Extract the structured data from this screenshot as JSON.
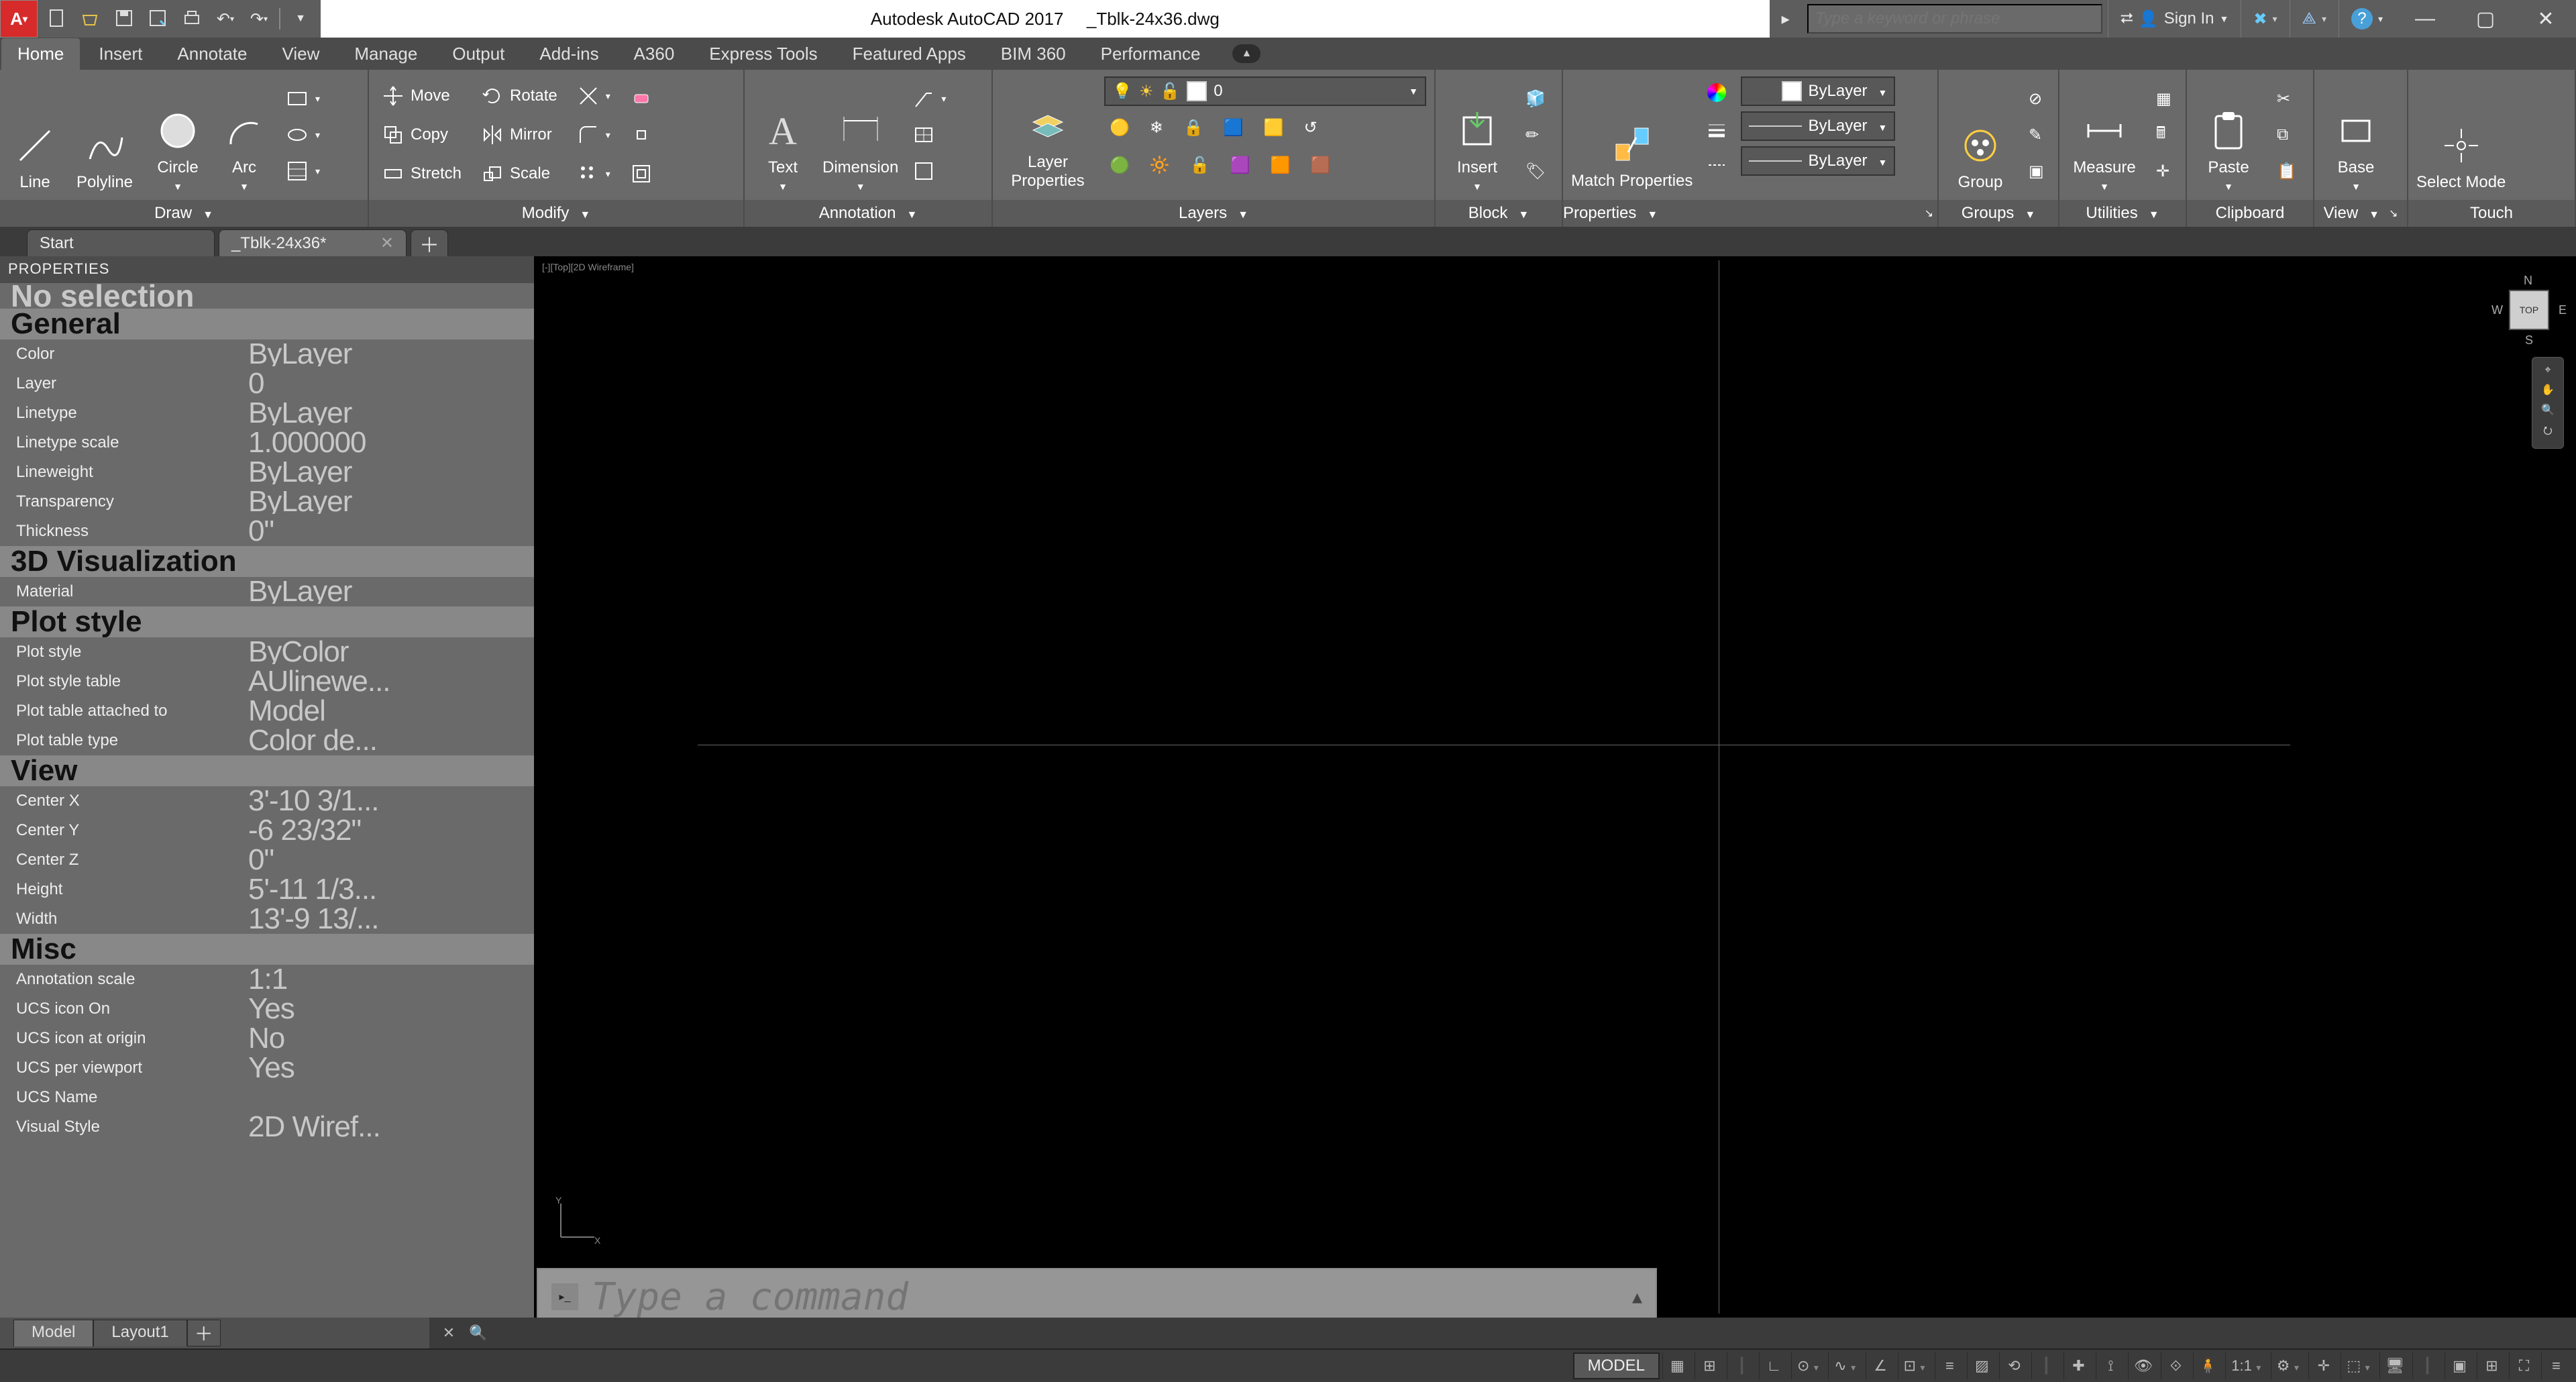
{
  "title": {
    "app": "Autodesk AutoCAD 2017",
    "file": "_Tblk-24x36.dwg"
  },
  "quick": [
    "new",
    "open",
    "save",
    "saveas",
    "undo",
    "redo"
  ],
  "topright": {
    "search_placeholder": "Type a keyword or phrase",
    "signin": "Sign In",
    "x_icon": "exchange",
    "help": "?"
  },
  "ribbon_tabs": [
    "Home",
    "Insert",
    "Annotate",
    "View",
    "Manage",
    "Output",
    "Add-ins",
    "A360",
    "Express Tools",
    "Featured Apps",
    "BIM 360",
    "Performance"
  ],
  "ribbon_active": 0,
  "ribbon": {
    "draw": {
      "label": "Draw",
      "items": [
        "Line",
        "Polyline",
        "Circle",
        "Arc"
      ]
    },
    "modify": {
      "label": "Modify",
      "items": [
        "Move",
        "Rotate",
        "Copy",
        "Mirror",
        "Stretch",
        "Scale"
      ]
    },
    "annotation": {
      "label": "Annotation",
      "items": [
        "Text",
        "Dimension"
      ]
    },
    "layers": {
      "label": "Layers",
      "layer_props": "Layer\nProperties",
      "current": "0"
    },
    "block": {
      "label": "Block",
      "insert": "Insert"
    },
    "properties": {
      "label": "Properties",
      "match": "Match\nProperties",
      "bylayer": "ByLayer"
    },
    "groups": {
      "label": "Groups",
      "group": "Group"
    },
    "utilities": {
      "label": "Utilities",
      "measure": "Measure"
    },
    "clipboard": {
      "label": "Clipboard",
      "paste": "Paste"
    },
    "view": {
      "label": "View",
      "base": "Base"
    },
    "touch": {
      "label": "Touch",
      "select": "Select\nMode"
    }
  },
  "file_tabs": [
    {
      "label": "Start",
      "active": false
    },
    {
      "label": "_Tblk-24x36*",
      "active": true
    }
  ],
  "palette": {
    "title": "PROPERTIES",
    "noselection": "No selection",
    "groups": [
      {
        "name": "General",
        "rows": [
          {
            "k": "Color",
            "v": "ByLayer"
          },
          {
            "k": "Layer",
            "v": "0"
          },
          {
            "k": "Linetype",
            "v": "ByLayer"
          },
          {
            "k": "Linetype scale",
            "v": "1.000000"
          },
          {
            "k": "Lineweight",
            "v": "ByLayer"
          },
          {
            "k": "Transparency",
            "v": "ByLayer"
          },
          {
            "k": "Thickness",
            "v": "0\""
          }
        ]
      },
      {
        "name": "3D Visualization",
        "rows": [
          {
            "k": "Material",
            "v": "ByLayer"
          }
        ]
      },
      {
        "name": "Plot style",
        "rows": [
          {
            "k": "Plot style",
            "v": "ByColor"
          },
          {
            "k": "Plot style table",
            "v": "AUlinewe..."
          },
          {
            "k": "Plot table attached to",
            "v": "Model"
          },
          {
            "k": "Plot table type",
            "v": "Color de..."
          }
        ]
      },
      {
        "name": "View",
        "rows": [
          {
            "k": "Center X",
            "v": "3'-10 3/1..."
          },
          {
            "k": "Center Y",
            "v": "-6 23/32\""
          },
          {
            "k": "Center Z",
            "v": "0\""
          },
          {
            "k": "Height",
            "v": "5'-11 1/3..."
          },
          {
            "k": "Width",
            "v": "13'-9 13/..."
          }
        ]
      },
      {
        "name": "Misc",
        "rows": [
          {
            "k": "Annotation scale",
            "v": "1:1"
          },
          {
            "k": "UCS icon On",
            "v": "Yes"
          },
          {
            "k": "UCS icon at origin",
            "v": "No"
          },
          {
            "k": "UCS per viewport",
            "v": "Yes"
          },
          {
            "k": "UCS Name",
            "v": ""
          },
          {
            "k": "Visual Style",
            "v": "2D Wiref..."
          }
        ]
      }
    ]
  },
  "viewport_tab": "[-][Top][2D Wireframe]",
  "viewcube_face": "TOP",
  "command_placeholder": "Type a command",
  "layout_tabs": [
    "Model",
    "Layout1"
  ],
  "layout_active": 0,
  "status": {
    "model": "MODEL",
    "scale": "1:1"
  }
}
